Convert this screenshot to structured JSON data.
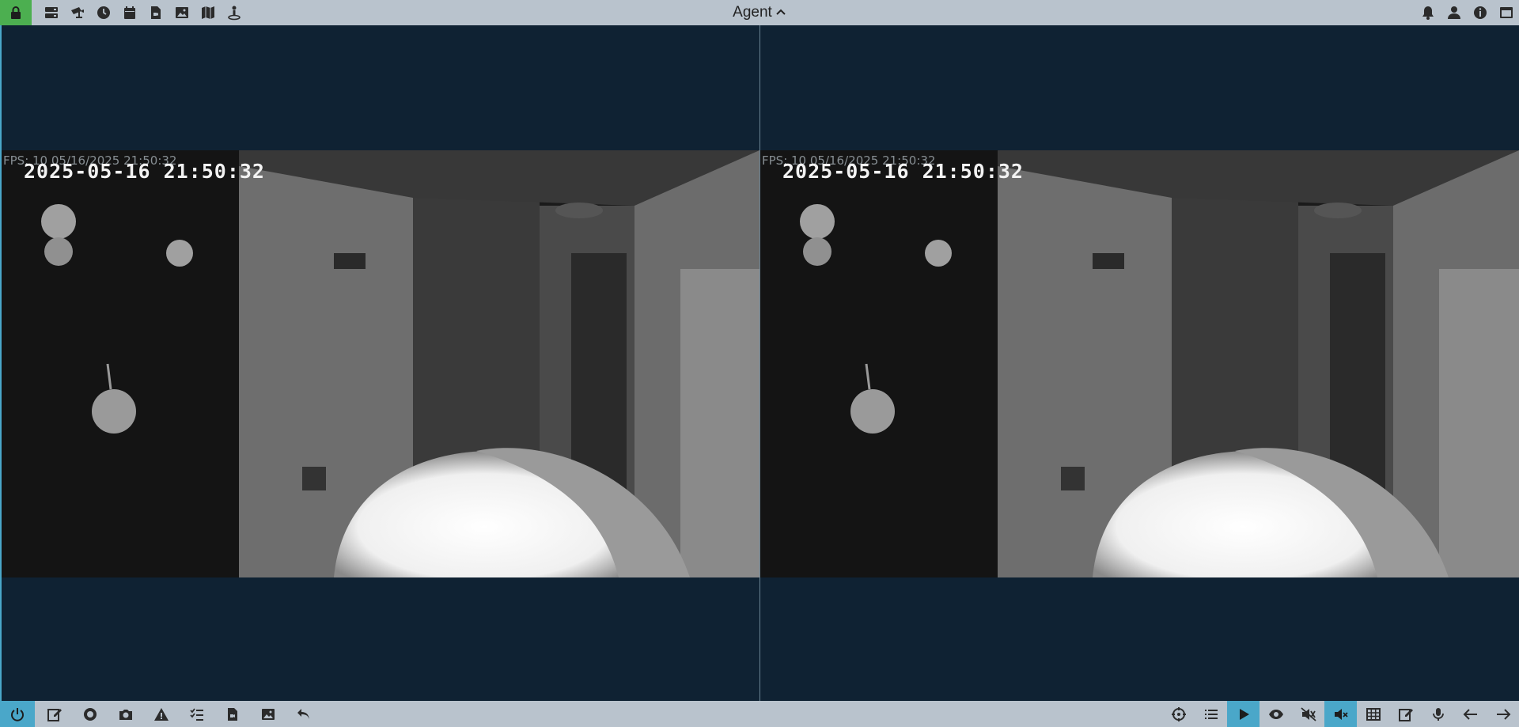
{
  "header": {
    "title": "Agent",
    "left_icons": [
      "lock-icon",
      "server-icon",
      "camera-icon",
      "clock-icon",
      "calendar-icon",
      "file-video-icon",
      "image-icon",
      "map-icon",
      "user-pin-icon"
    ],
    "right_icons": [
      "bell-icon",
      "user-icon",
      "info-icon",
      "window-icon"
    ]
  },
  "cameras": [
    {
      "fps_text": "FPS: 10 05/16/2025 21:50:32",
      "timestamp": "2025-05-16  21:50:32"
    },
    {
      "fps_text": "FPS: 10 05/16/2025 21:50:32",
      "timestamp": "2025-05-16  21:50:32"
    }
  ],
  "footer": {
    "left_icons": [
      "power-icon",
      "edit-icon",
      "record-icon",
      "snapshot-icon",
      "alert-icon",
      "checklist-icon",
      "file-video-icon",
      "image-icon",
      "undo-icon"
    ],
    "right_icons": [
      "crosshair-icon",
      "list-icon",
      "play-icon",
      "eye-icon",
      "mute-icon",
      "speaker-mute-icon",
      "grid-icon",
      "edit-icon",
      "mic-icon",
      "arrow-left-icon",
      "arrow-right-icon"
    ]
  },
  "colors": {
    "accent": "#4aa7c9",
    "lock_green": "#4caf50",
    "bar_bg": "#b9c3cd",
    "stage_bg": "#0e2233"
  }
}
